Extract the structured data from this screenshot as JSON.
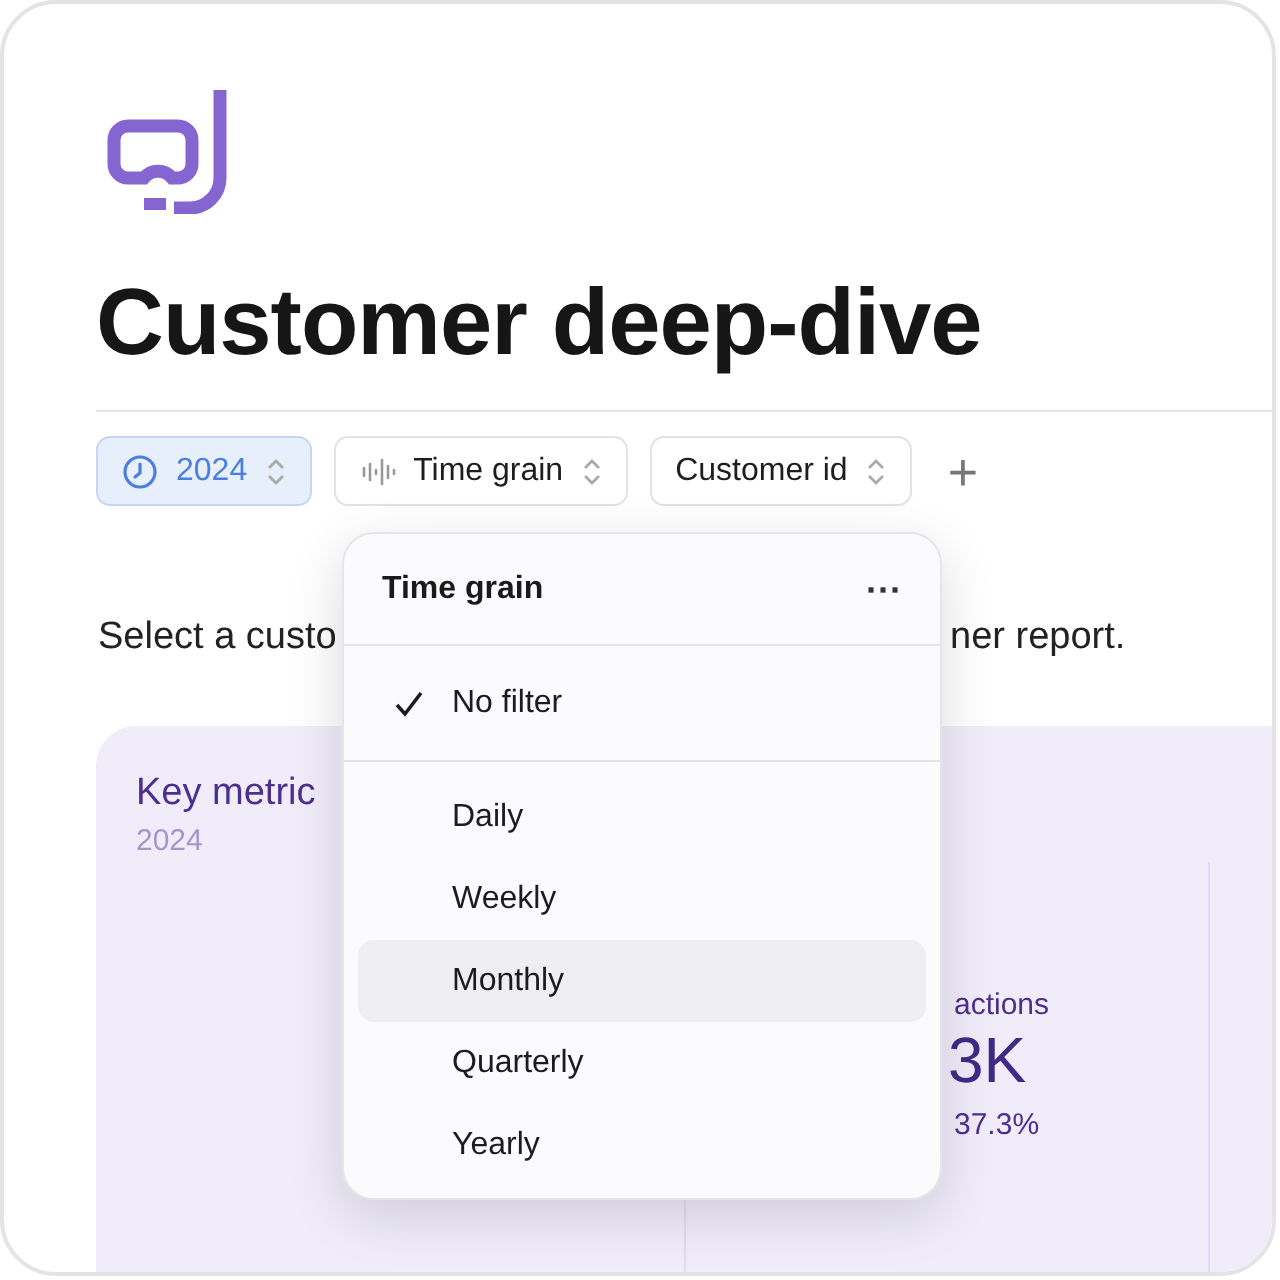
{
  "title": "Customer deep-dive",
  "filters": [
    {
      "label": "2024",
      "kind": "date",
      "selected": true
    },
    {
      "label": "Time grain",
      "kind": "dimension",
      "selected": false
    },
    {
      "label": "Customer id",
      "kind": "field",
      "selected": false
    }
  ],
  "add_filter": "+",
  "description_parts": [
    "Select a custo",
    "ner report."
  ],
  "card": {
    "title": "Key metric",
    "subtitle": "2024",
    "metric_label": "actions",
    "metric_value": "3K",
    "metric_change": "37.3%"
  },
  "dropdown": {
    "title": "Time grain",
    "menu": "···",
    "items": [
      {
        "label": "No filter",
        "checked": true,
        "highlighted": false
      },
      {
        "label": "Daily",
        "checked": false,
        "highlighted": false
      },
      {
        "label": "Weekly",
        "checked": false,
        "highlighted": false
      },
      {
        "label": "Monthly",
        "checked": false,
        "highlighted": true
      },
      {
        "label": "Quarterly",
        "checked": false,
        "highlighted": false
      },
      {
        "label": "Yearly",
        "checked": false,
        "highlighted": false
      }
    ]
  }
}
